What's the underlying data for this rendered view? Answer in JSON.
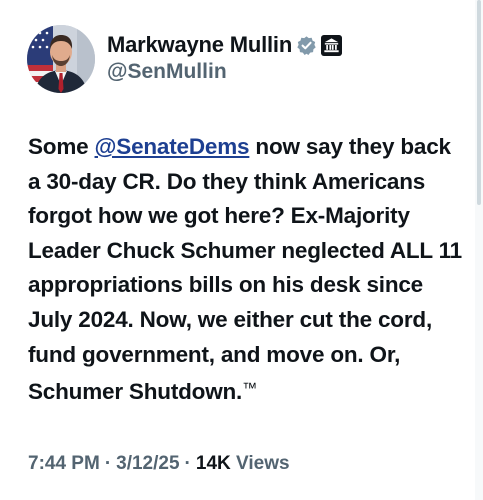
{
  "author": {
    "display_name": "Markwayne Mullin",
    "handle": "@SenMullin",
    "verified_badge": "verified-badge-icon",
    "affiliation_badge": "government-building-icon",
    "verified_color": "#829aab"
  },
  "tweet": {
    "text_before_mention": "Some ",
    "mention": "@SenateDems",
    "text_after_mention": " now say they back a 30-day CR. Do they think Americans forgot how we got here? Ex-Majority Leader Chuck Schumer neglected ALL 11 appropriations bills on his desk since July 2024. Now, we either cut the cord, fund government, and move on. Or, Schumer Shutdown.",
    "trademark": "™",
    "mention_color": "#1d3f91"
  },
  "meta": {
    "time": "7:44 PM",
    "separator": "·",
    "date": "3/12/25",
    "views_count": "14K",
    "views_label": "Views"
  }
}
